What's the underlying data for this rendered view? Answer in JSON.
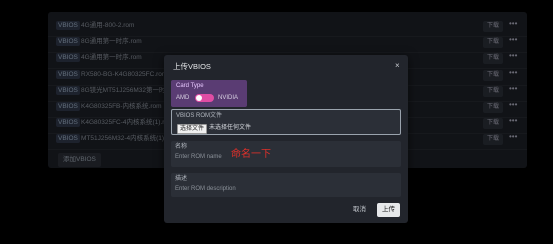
{
  "rows": [
    {
      "tag": "VBIOS",
      "name": "4G通用-800-2.rom",
      "download": "下载",
      "more": "•••"
    },
    {
      "tag": "VBIOS",
      "name": "8G通用第一时序.rom",
      "download": "下载",
      "more": "•••"
    },
    {
      "tag": "VBIOS",
      "name": "4G通用第一时序.rom",
      "download": "下载",
      "more": "•••"
    },
    {
      "tag": "VBIOS",
      "name": "RX580-BG-K4G80325FC.rom",
      "download": "下载",
      "more": "•••"
    },
    {
      "tag": "VBIOS",
      "name": "8G镁光MT51J256M32第一时序.rom",
      "download": "下载",
      "more": "•••"
    },
    {
      "tag": "VBIOS",
      "name": "K4G80325FB-内核系统.rom",
      "download": "下载",
      "more": "•••"
    },
    {
      "tag": "VBIOS",
      "name": "K4G80325FC-4内核系统(1).rom",
      "download": "下载",
      "more": "•••"
    },
    {
      "tag": "VBIOS",
      "name": "MT51J256M32-4内核系统(1).rom",
      "download": "下载",
      "more": "•••"
    }
  ],
  "add_button": "添加VBIOS",
  "modal": {
    "title": "上传VBIOS",
    "close": "×",
    "card_type": {
      "label": "Card Type",
      "left": "AMD",
      "right": "NVIDIA"
    },
    "rom": {
      "label": "VBIOS ROM文件",
      "choose": "选择文件",
      "none": "未选择任何文件"
    },
    "name": {
      "label": "名称",
      "placeholder": "Enter ROM name",
      "annotation": "命名一下"
    },
    "desc": {
      "label": "描述",
      "placeholder": "Enter ROM description"
    },
    "cancel": "取消",
    "submit": "上传"
  }
}
